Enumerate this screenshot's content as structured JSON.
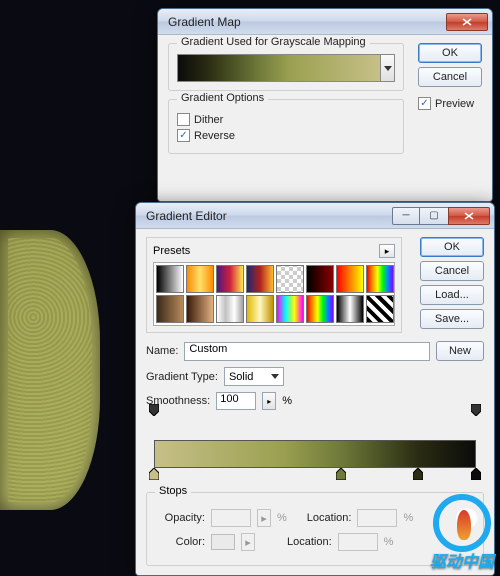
{
  "gm": {
    "title": "Gradient Map",
    "section1": "Gradient Used for Grayscale Mapping",
    "section2": "Gradient Options",
    "dither_label": "Dither",
    "dither_checked": false,
    "reverse_label": "Reverse",
    "reverse_checked": true,
    "ok": "OK",
    "cancel": "Cancel",
    "preview_label": "Preview",
    "preview_checked": true,
    "gradient_css": "linear-gradient(to right, #0b0b0b 0%, #2a2d12 15%, #6f7a3a 40%, #9aa050 55%, #c6c088 100%)"
  },
  "ge": {
    "title": "Gradient Editor",
    "presets_label": "Presets",
    "ok": "OK",
    "cancel": "Cancel",
    "load": "Load...",
    "save": "Save...",
    "name_label": "Name:",
    "name_value": "Custom",
    "new": "New",
    "type_label": "Gradient Type:",
    "type_value": "Solid",
    "smooth_label": "Smoothness:",
    "smooth_value": "100",
    "percent": "%",
    "editor_gradient_css": "linear-gradient(to right, #c6c088 0%, #9aa050 40%, #6f7a3a 58%, #2a2d12 82%, #0b0b0b 100%)",
    "stops_label": "Stops",
    "opacity_label": "Opacity:",
    "color_label": "Color:",
    "location_label": "Location:",
    "presets": [
      "linear-gradient(to right,#000,#fff)",
      "linear-gradient(to right,#ff8a00,#ffe16b,#ff8a00)",
      "linear-gradient(to right,#4a1a7a,#d11f3c,#ffe84a)",
      "linear-gradient(to right,#1a2a6c,#b21f1f,#fdbb2d)",
      "repeating-conic-gradient(#ccc 0 25%,#fff 0 50%) 0/8px 8px",
      "linear-gradient(to right,#000,#8a0000)",
      "linear-gradient(to right,#ff0000,#ffff00)",
      "linear-gradient(to right,#ff0000,#ff8800,#ffff00,#00ff00,#0088ff,#8a00ff)",
      "linear-gradient(to right,#3a2a1a,#b88a5a)",
      "linear-gradient(to right,#3a1a0a,#e0b080)",
      "linear-gradient(to right,#fff,#c0c0c0,#fff,#a0a0a0)",
      "linear-gradient(to right,#e0b800,#fff8c0,#c09000)",
      "linear-gradient(to right,#ff00ff,#00ffff,#ffff00,#ff00ff)",
      "linear-gradient(to right,#ff0000,#ff8800,#ffff00,#00ff00,#0088ff,#8a00ff)",
      "linear-gradient(to right,#000,#fff,#000)",
      "repeating-linear-gradient(45deg,#000 0 4px,#fff 4px 8px)"
    ],
    "bottom_stops": [
      {
        "pos": 0,
        "color": "#c6c088"
      },
      {
        "pos": 58,
        "color": "#6f7a3a"
      },
      {
        "pos": 82,
        "color": "#2a2d12"
      },
      {
        "pos": 100,
        "color": "#0b0b0b"
      }
    ],
    "top_stops": [
      {
        "pos": 0
      },
      {
        "pos": 100
      }
    ]
  },
  "watermark": "驱动中国"
}
